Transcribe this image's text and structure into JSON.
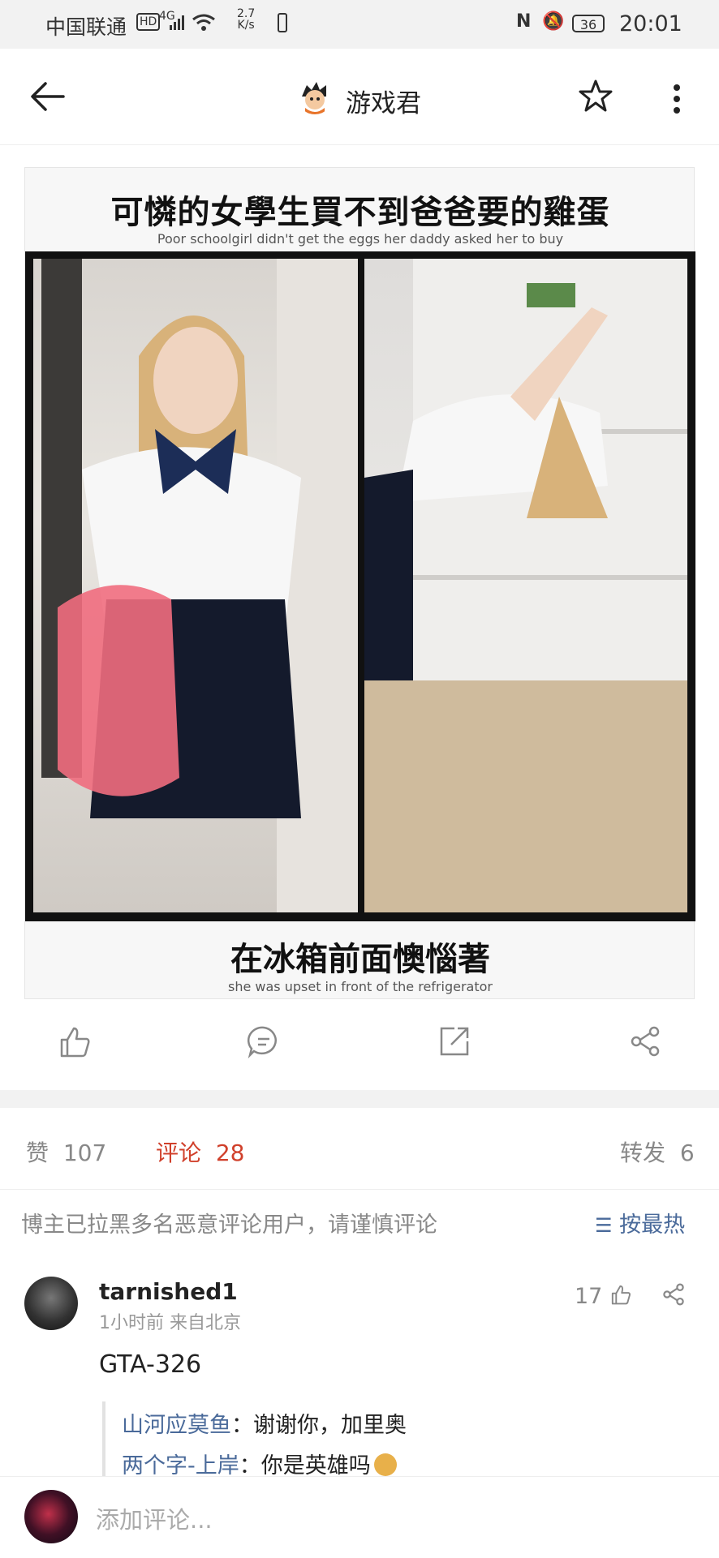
{
  "status_bar": {
    "carrier": "中国联通",
    "network_speed": "2.7",
    "network_unit": "K/s",
    "signal": "4G",
    "battery": "36",
    "time": "20:01"
  },
  "header": {
    "title": "游戏君"
  },
  "post": {
    "caption_top_zh": "可憐的女學生買不到爸爸要的雞蛋",
    "caption_top_en": "Poor schoolgirl didn't get the eggs her daddy asked her to buy",
    "caption_bottom_zh": "在冰箱前面懊惱著",
    "caption_bottom_en": "she was upset in front of the refrigerator"
  },
  "stats": {
    "likes_label": "赞",
    "likes_count": "107",
    "comments_label": "评论",
    "comments_count": "28",
    "reposts_label": "转发",
    "reposts_count": "6"
  },
  "comments_section": {
    "notice": "博主已拉黑多名恶意评论用户，请谨慎评论",
    "sort_label": "按最热"
  },
  "comment": {
    "username": "tarnished1",
    "meta": "1小时前  来自北京",
    "text": "GTA-326",
    "likes": "17",
    "replies": [
      {
        "name": "山河应莫鱼",
        "text": "：谢谢你，加里奥"
      },
      {
        "name": "两个字-上岸",
        "text": "：你是英雄吗"
      }
    ]
  },
  "composer": {
    "placeholder": "添加评论..."
  },
  "colors": {
    "accent": "#d0402b",
    "link": "#4a6a9a"
  }
}
